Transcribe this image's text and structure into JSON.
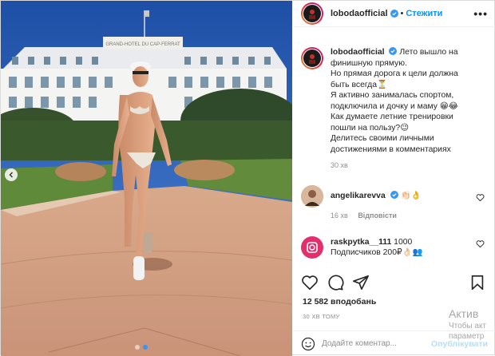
{
  "post": {
    "username": "lobodaofficial",
    "follow_label": "Стежити",
    "separator": "•",
    "more_label": "•••"
  },
  "caption": {
    "username": "lobodaofficial",
    "lines": [
      "Лето вышло на",
      "финишную прямую.",
      "Но прямая дорога к цели должна",
      "быть всегда",
      "Я активно занималась спортом,",
      "подключила и дочку и маму",
      "Как думаете летние тренировки",
      "пошли на пользу?",
      "Делитесь своими личными",
      "достижениями в комментариях"
    ],
    "emoji_after_line_4": "⏳",
    "emoji_after_line_6": "😁😂",
    "emoji_after_line_8": "😉",
    "time": "30 хв"
  },
  "comments": [
    {
      "username": "angelikarevva",
      "text": "👏🏻👌",
      "time": "16 хв",
      "reply_label": "Відповісти"
    },
    {
      "username": "raskpytka__111",
      "text_line1": "1000",
      "text_line2": "Подписчиков 200₽👌🏻👥"
    }
  ],
  "likes_label": "12 582 вподобань",
  "timestamp": "30 ХВ ТОМУ",
  "comment_input": {
    "placeholder": "Додайте коментар...",
    "publish_label": "Опублікувати"
  },
  "watermark": {
    "line1": "Актив",
    "line2": "Чтобы акт",
    "line3": "параметр"
  },
  "image": {
    "building_sign": "GRAND-HOTEL DU CAP-FERRAT"
  },
  "colors": {
    "accent": "#0095f6",
    "verified": "#3897f0",
    "text": "#262626",
    "muted": "#8e8e8e"
  }
}
